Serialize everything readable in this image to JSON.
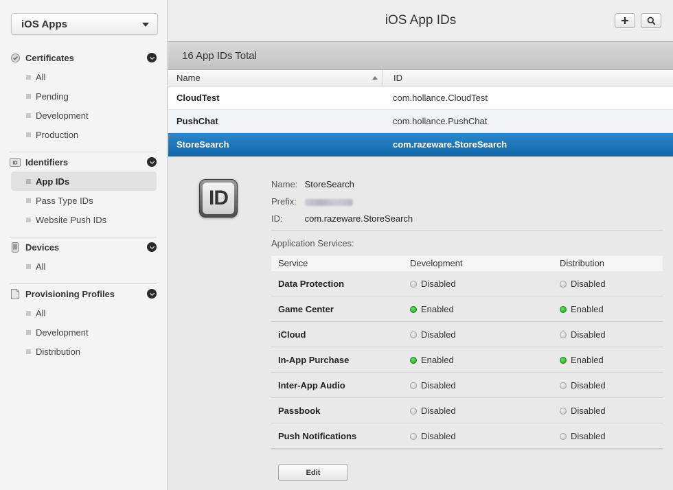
{
  "sidebar": {
    "platform": "iOS Apps",
    "sections": [
      {
        "title": "Certificates",
        "icon": "certificate-icon",
        "items": [
          "All",
          "Pending",
          "Development",
          "Production"
        ]
      },
      {
        "title": "Identifiers",
        "icon": "id-badge-icon",
        "items": [
          "App IDs",
          "Pass Type IDs",
          "Website Push IDs"
        ],
        "selected": "App IDs"
      },
      {
        "title": "Devices",
        "icon": "device-icon",
        "items": [
          "All"
        ]
      },
      {
        "title": "Provisioning Profiles",
        "icon": "document-icon",
        "items": [
          "All",
          "Development",
          "Distribution"
        ]
      }
    ]
  },
  "header": {
    "title": "iOS App IDs"
  },
  "list": {
    "total_label": "16 App IDs Total",
    "columns": [
      "Name",
      "ID"
    ],
    "rows": [
      {
        "name": "CloudTest",
        "id": "com.hollance.CloudTest"
      },
      {
        "name": "PushChat",
        "id": "com.hollance.PushChat"
      },
      {
        "name": "StoreSearch",
        "id": "com.razeware.StoreSearch",
        "selected": true
      }
    ]
  },
  "detail": {
    "icon_label": "ID",
    "name_label": "Name:",
    "name_value": "StoreSearch",
    "prefix_label": "Prefix:",
    "id_label": "ID:",
    "id_value": "com.razeware.StoreSearch",
    "services_label": "Application Services:",
    "service_columns": [
      "Service",
      "Development",
      "Distribution"
    ],
    "services": [
      {
        "service": "Data Protection",
        "development": "Disabled",
        "distribution": "Disabled"
      },
      {
        "service": "Game Center",
        "development": "Enabled",
        "distribution": "Enabled"
      },
      {
        "service": "iCloud",
        "development": "Disabled",
        "distribution": "Disabled"
      },
      {
        "service": "In-App Purchase",
        "development": "Enabled",
        "distribution": "Enabled"
      },
      {
        "service": "Inter-App Audio",
        "development": "Disabled",
        "distribution": "Disabled"
      },
      {
        "service": "Passbook",
        "development": "Disabled",
        "distribution": "Disabled"
      },
      {
        "service": "Push Notifications",
        "development": "Disabled",
        "distribution": "Disabled"
      }
    ],
    "edit_label": "Edit"
  },
  "colors": {
    "selection": "#1a74b9",
    "enabled": "#22b022",
    "disabled": "#c4c4c4"
  }
}
